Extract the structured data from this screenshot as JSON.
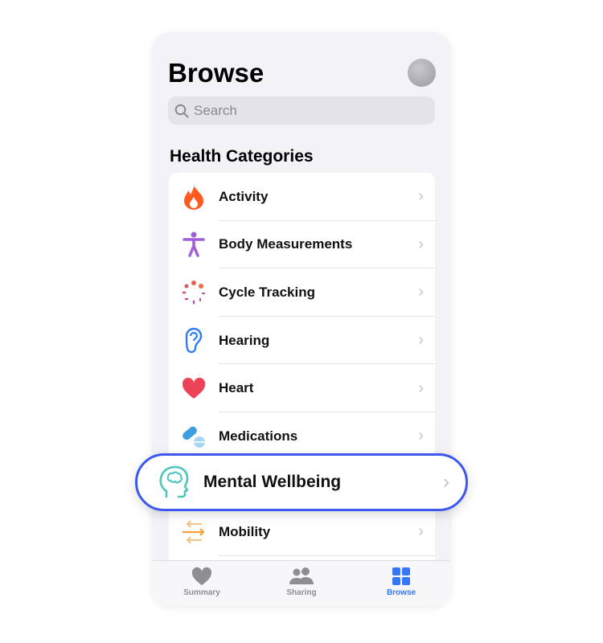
{
  "header": {
    "title": "Browse"
  },
  "search": {
    "placeholder": "Search"
  },
  "section_title": "Health Categories",
  "categories": [
    {
      "label": "Activity",
      "icon": "flame-icon",
      "color": "#ff5a1f"
    },
    {
      "label": "Body Measurements",
      "icon": "body-figure-icon",
      "color": "#a05ed8"
    },
    {
      "label": "Cycle Tracking",
      "icon": "cycle-dots-icon",
      "color": "#e0605a"
    },
    {
      "label": "Hearing",
      "icon": "ear-icon",
      "color": "#2f7cf6"
    },
    {
      "label": "Heart",
      "icon": "heart-icon",
      "color": "#ec4359"
    },
    {
      "label": "Medications",
      "icon": "pills-icon",
      "color": "#4ea6e0"
    },
    {
      "label": "Mobility",
      "icon": "arrows-icon",
      "color": "#f4a13c"
    }
  ],
  "highlighted": {
    "label": "Mental Wellbeing",
    "icon": "brain-head-icon",
    "color": "#4cc5bc",
    "border_color": "#3d58f0"
  },
  "tabs": [
    {
      "label": "Summary",
      "icon": "heart-icon"
    },
    {
      "label": "Sharing",
      "icon": "people-icon"
    },
    {
      "label": "Browse",
      "icon": "grid-icon",
      "active": true,
      "color": "#3478f6"
    }
  ]
}
